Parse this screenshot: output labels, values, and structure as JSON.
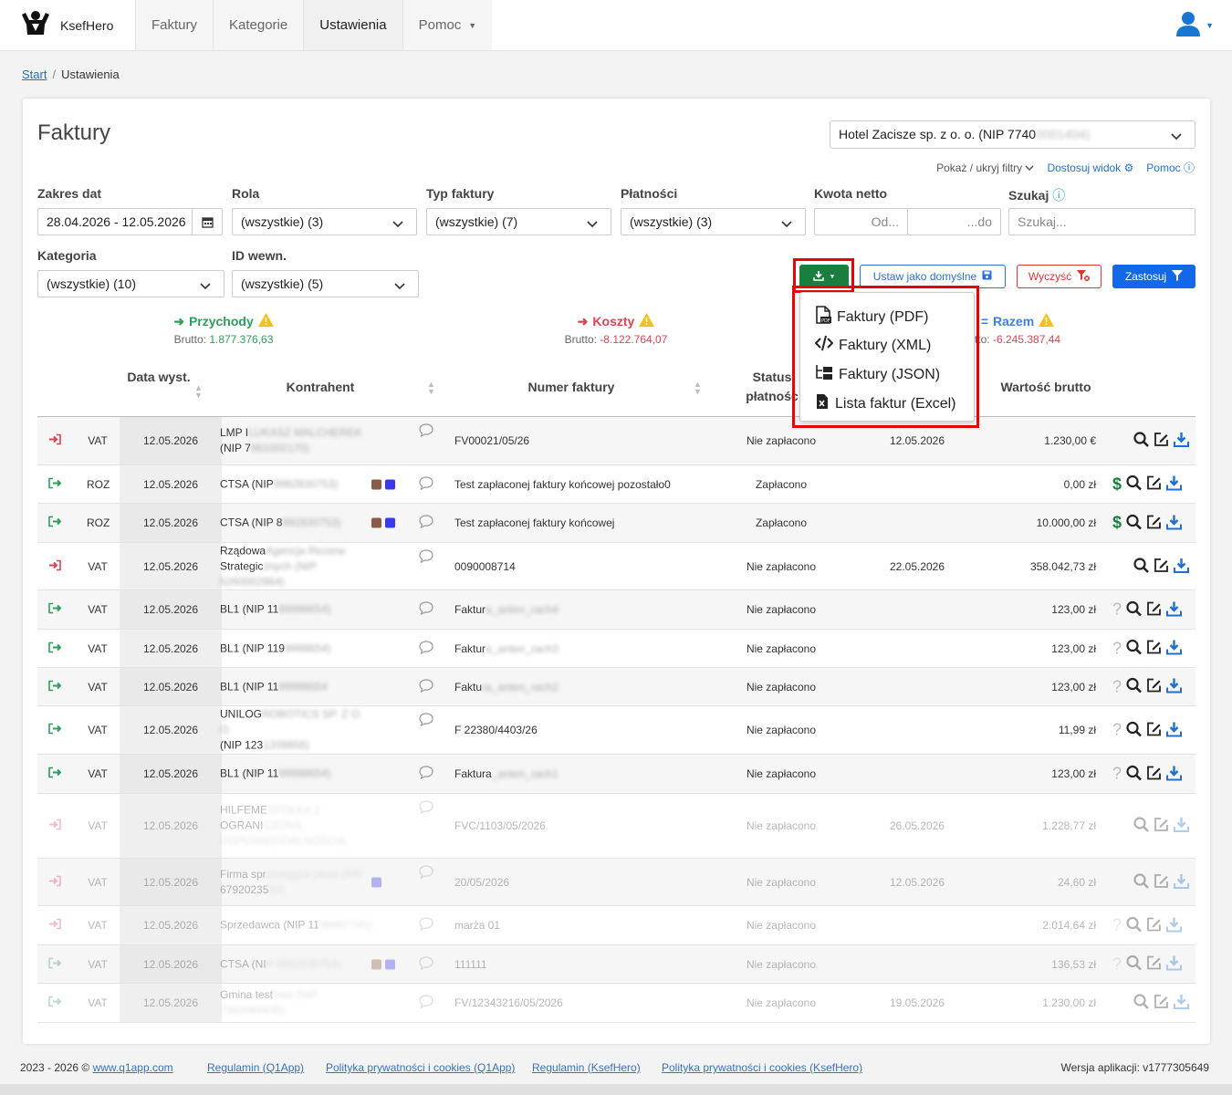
{
  "app": {
    "name": "KsefHero"
  },
  "nav": {
    "tabs": [
      {
        "label": "Faktury"
      },
      {
        "label": "Kategorie"
      },
      {
        "label": "Ustawienia"
      },
      {
        "label": "Pomoc"
      }
    ]
  },
  "breadcrumb": {
    "home": "Start",
    "current": "Ustawienia"
  },
  "page": {
    "title": "Faktury"
  },
  "company": {
    "name_visible": "Hotel Zacisze sp. z o. o. (NIP 7740",
    "name_blurred": "0001404)"
  },
  "links": {
    "toggle_filters": "Pokaż / ukryj filtry",
    "customize": "Dostosuj widok",
    "help": "Pomoc"
  },
  "filters": {
    "date_range": {
      "label": "Zakres dat",
      "value": "28.04.2026 - 12.05.2026"
    },
    "role": {
      "label": "Rola",
      "value": "(wszystkie) (3)"
    },
    "invoice_type": {
      "label": "Typ faktury",
      "value": "(wszystkie) (7)"
    },
    "payments": {
      "label": "Płatności",
      "value": "(wszystkie) (3)"
    },
    "net_amount": {
      "label": "Kwota netto",
      "from_placeholder": "Od...",
      "to_placeholder": "...do"
    },
    "search": {
      "label": "Szukaj",
      "placeholder": "Szukaj..."
    },
    "category": {
      "label": "Kategoria",
      "value": "(wszystkie) (10)"
    },
    "internal_id": {
      "label": "ID wewn.",
      "value": "(wszystkie) (5)"
    }
  },
  "buttons": {
    "set_default": "Ustaw jako domyślne",
    "clear": "Wyczyść",
    "apply": "Zastosuj"
  },
  "export_menu": {
    "items": [
      {
        "label": "Faktury (PDF)"
      },
      {
        "label": "Faktury (XML)"
      },
      {
        "label": "Faktury (JSON)"
      },
      {
        "label": "Lista faktur (Excel)"
      }
    ]
  },
  "summary": {
    "income": {
      "label": "Przychody",
      "gross_label": "Brutto:",
      "gross": "1.877.376,63"
    },
    "costs": {
      "label": "Koszty",
      "gross_label": "Brutto:",
      "gross": "-8.122.764,07"
    },
    "total": {
      "label": "Razem",
      "gross_label": "tto:",
      "gross": "-6.245.387,44"
    }
  },
  "colors": {
    "income": "#2e9e5b",
    "costs": "#d94452",
    "total": "#3d82d8",
    "warning": "#f2c21b"
  },
  "table": {
    "headers": {
      "date": "Data wyst.",
      "party": "Kontrahent",
      "number": "Numer faktury",
      "status": "Status płatnośc",
      "gross": "Wartość brutto"
    },
    "rows": [
      {
        "dir": "in",
        "type": "VAT",
        "date": "12.05.2026",
        "party_l1": "LMP I",
        "party_l1b": "LUKASZ MALCHEREK",
        "party_l2": "(NIP 7",
        "party_l2b": "961002170)",
        "tags": [],
        "number": "FV00021/05/26",
        "number_b": "",
        "status": "Nie zapłacono",
        "due": "12.05.2026",
        "gross": "1.230,00 €",
        "dollar": false,
        "question": false,
        "height": 53
      },
      {
        "dir": "out",
        "type": "ROZ",
        "date": "12.05.2026",
        "party_l1": "CTSA (NIP",
        "party_l1b": "9992830753)",
        "party_l2": "",
        "party_l2b": "",
        "tags": [
          "#8b5a4a",
          "#3a3ae8"
        ],
        "number": "Test zapłaconej faktury końcowej pozostało0",
        "number_b": "",
        "status": "Zapłacono",
        "due": "",
        "gross": "0,00 zł",
        "dollar": true,
        "question": false,
        "height": 42
      },
      {
        "dir": "out",
        "type": "ROZ",
        "date": "12.05.2026",
        "party_l1": "CTSA (NIP 8",
        "party_l1b": "992830753)",
        "party_l2": "",
        "party_l2b": "",
        "tags": [
          "#8b5a4a",
          "#3a3ae8"
        ],
        "number": "Test zapłaconej faktury końcowej",
        "number_b": "",
        "status": "Zapłacono",
        "due": "",
        "gross": "10.000,00 zł",
        "dollar": true,
        "question": false,
        "height": 43
      },
      {
        "dir": "in",
        "type": "VAT",
        "date": "12.05.2026",
        "party_l1": "Rządowa",
        "party_l1b": "Agencja Rezerw",
        "party_l2": "Strategic",
        "party_l2b": "znych (NIP 5260002864)",
        "tags": [],
        "number": "0090008714",
        "number_b": "",
        "status": "Nie zapłacono",
        "due": "22.05.2026",
        "gross": "358.042,73 zł",
        "dollar": false,
        "question": false,
        "height": 52
      },
      {
        "dir": "out",
        "type": "VAT",
        "date": "12.05.2026",
        "party_l1": "BL1 (NIP 11",
        "party_l1b": "99998654)",
        "party_l2": "",
        "party_l2b": "",
        "tags": [],
        "number": "Faktur",
        "number_b": "a_anten_rach4",
        "status": "Nie zapłacono",
        "due": "",
        "gross": "123,00 zł",
        "dollar": false,
        "question": true,
        "height": 43
      },
      {
        "dir": "out",
        "type": "VAT",
        "date": "12.05.2026",
        "party_l1": "BL1 (NIP 119",
        "party_l1b": "9998654)",
        "party_l2": "",
        "party_l2b": "",
        "tags": [],
        "number": "Faktur",
        "number_b": "a_anten_rach3",
        "status": "Nie zapłacono",
        "due": "",
        "gross": "123,00 zł",
        "dollar": false,
        "question": true,
        "height": 42
      },
      {
        "dir": "out",
        "type": "VAT",
        "date": "12.05.2026",
        "party_l1": "BL1 (NIP 11",
        "party_l1b": "99998654",
        "party_l2": "",
        "party_l2b": "",
        "tags": [],
        "number": "Faktu",
        "number_b": "ra_anten_rach2",
        "status": "Nie zapłacono",
        "due": "",
        "gross": "123,00 zł",
        "dollar": false,
        "question": true,
        "height": 42
      },
      {
        "dir": "out",
        "type": "VAT",
        "date": "12.05.2026",
        "party_l1": "UNILOG",
        "party_l1b": "ROBOTICS SP. Z O. O.",
        "party_l2": "(NIP 123",
        "party_l2b": "1209856)",
        "tags": [],
        "number": "F 22380/4403/26",
        "number_b": "",
        "status": "Nie zapłacono",
        "due": "",
        "gross": "11,99 zł",
        "dollar": false,
        "question": true,
        "height": 53
      },
      {
        "dir": "out",
        "type": "VAT",
        "date": "12.05.2026",
        "party_l1": "BL1 (NIP 11",
        "party_l1b": "99998654)",
        "party_l2": "",
        "party_l2b": "",
        "tags": [],
        "number": "Faktura",
        "number_b": "_anten_rach1",
        "status": "Nie zapłacono",
        "due": "",
        "gross": "123,00 zł",
        "dollar": false,
        "question": true,
        "height": 43
      },
      {
        "dir": "in",
        "type": "VAT",
        "date": "12.05.2026",
        "party_l1": "HILFEME",
        "party_l1b": "SPÓŁKA Z",
        "party_l2": "OGRANI",
        "party_l2b": "CZONĄ ODPOWIEDZIALNOŚCIĄ",
        "tags": [],
        "number": "FVC/1103/05/2026",
        "number_b": "",
        "status": "Nie zapłacono",
        "due": "26.05.2026",
        "gross": "1.228,77 zł",
        "dollar": false,
        "question": false,
        "height": 71,
        "faded": true
      },
      {
        "dir": "in",
        "type": "VAT",
        "date": "12.05.2026",
        "party_l1": "Firma spr",
        "party_l1b": "zedająca jakaś (NIP",
        "party_l2": "67920235",
        "party_l2b": "92)",
        "tags": [
          "#3a3ae8"
        ],
        "number": "20/05/2026",
        "number_b": "",
        "status": "Nie zapłacono",
        "due": "12.05.2026",
        "gross": "24,60 zł",
        "dollar": false,
        "question": false,
        "height": 52,
        "faded": true
      },
      {
        "dir": "in",
        "type": "VAT",
        "date": "12.05.2026",
        "party_l1": "Sprzedawca (NIP 11",
        "party_l1b": "48667745)",
        "party_l2": "",
        "party_l2b": "",
        "tags": [],
        "number": "marża 01",
        "number_b": "",
        "status": "Nie zapłacono",
        "due": "",
        "gross": "2.014,64 zł",
        "dollar": false,
        "question": true,
        "height": 43,
        "faded": true
      },
      {
        "dir": "out",
        "type": "VAT",
        "date": "12.05.2026",
        "party_l1": "CTSA (NI",
        "party_l1b": "P 9992830753)",
        "party_l2": "",
        "party_l2b": "",
        "tags": [
          "#8b5a4a",
          "#3a3ae8"
        ],
        "number": "111111",
        "number_b": "",
        "status": "Nie zapłacono",
        "due": "",
        "gross": "136,53 zł",
        "dollar": false,
        "question": true,
        "height": 42,
        "faded": true
      },
      {
        "dir": "out",
        "type": "VAT",
        "date": "12.05.2026",
        "party_l1": "Gmina test",
        "party_l1b": "owa (NIP 7382089435)",
        "party_l2": "",
        "party_l2b": "",
        "tags": [],
        "number": "FV/12343216/05/2026",
        "number_b": "",
        "status": "Nie zapłacono",
        "due": "19.05.2026",
        "gross": "1.230,00 zł",
        "dollar": false,
        "question": false,
        "height": 43,
        "faded": true
      }
    ]
  },
  "footer": {
    "copyright": "2023 - 2026 ©",
    "site": "www.q1app.com",
    "links": [
      {
        "label": "Regulamin (Q1App)"
      },
      {
        "label": "Polityka prywatności i cookies (Q1App)"
      },
      {
        "label": "Regulamin (KsefHero)"
      },
      {
        "label": "Polityka prywatności i cookies (KsefHero)"
      }
    ],
    "version": "Wersja aplikacji: v1777305649"
  }
}
